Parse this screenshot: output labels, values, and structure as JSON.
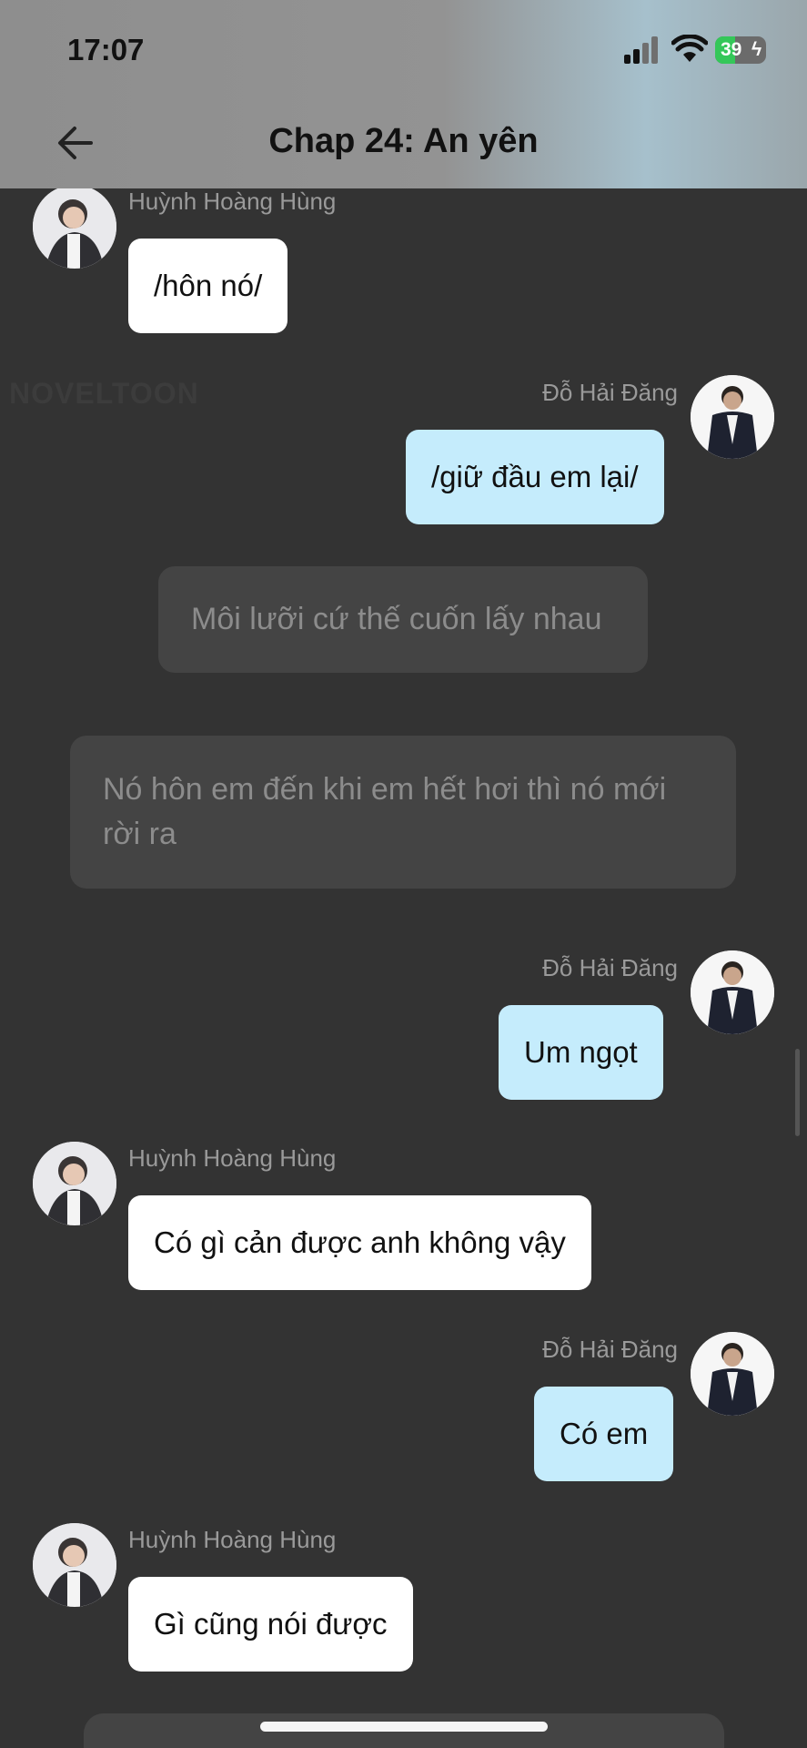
{
  "status_bar": {
    "time": "17:07",
    "battery": "39"
  },
  "header": {
    "title": "Chap 24: An yên"
  },
  "watermark": "NOVELTOON",
  "messages": [
    {
      "sender": "Huỳnh Hoàng Hùng",
      "text": "/hôn nó/"
    },
    {
      "sender": "Đỗ Hải Đăng",
      "text": "/giữ đầu em lại/"
    },
    {
      "narration": "Môi lưỡi cứ thế cuốn lấy nhau"
    },
    {
      "narration": "Nó hôn em đến khi em hết hơi thì nó mới rời ra"
    },
    {
      "sender": "Đỗ Hải Đăng",
      "text": "Um ngọt"
    },
    {
      "sender": "Huỳnh Hoàng Hùng",
      "text": "Có gì cản được anh không vậy"
    },
    {
      "sender": "Đỗ Hải Đăng",
      "text": "Có em"
    },
    {
      "sender": "Huỳnh Hoàng Hùng",
      "text": "Gì cũng nói được"
    }
  ]
}
